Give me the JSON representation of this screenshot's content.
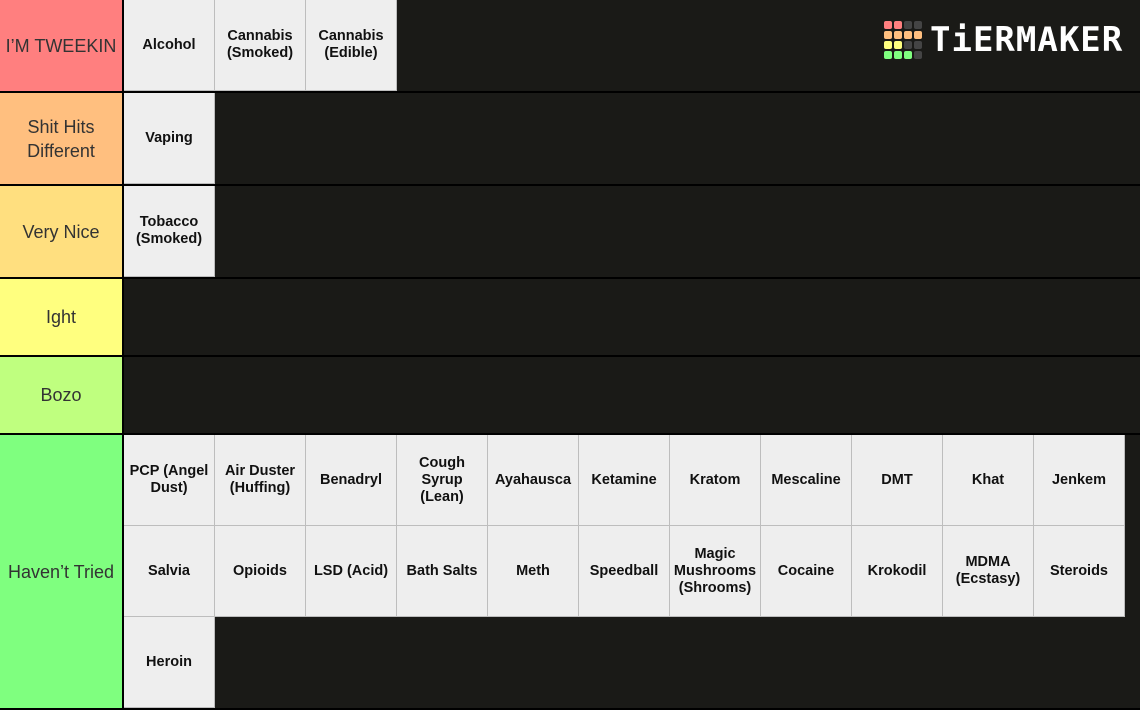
{
  "brand": {
    "name": "TiERMAKER",
    "grid_colors": [
      "#ff7f7f",
      "#ff7f7f",
      "#444444",
      "#444444",
      "#ffbf7f",
      "#ffbf7f",
      "#ffbf7f",
      "#ffbf7f",
      "#ffff7f",
      "#ffff7f",
      "#444444",
      "#444444",
      "#7fff7f",
      "#7fff7f",
      "#7fff7f",
      "#444444"
    ]
  },
  "tiers": [
    {
      "label": "I’M TWEEKIN",
      "color": "#ff7f7f",
      "items": [
        "Alcohol",
        "Cannabis (Smoked)",
        "Cannabis (Edible)"
      ]
    },
    {
      "label": "Shit Hits Different",
      "color": "#ffbf7f",
      "items": [
        "Vaping"
      ]
    },
    {
      "label": "Very Nice",
      "color": "#ffdf7f",
      "items": [
        "Tobacco (Smoked)"
      ]
    },
    {
      "label": "Ight",
      "color": "#ffff7f",
      "items": []
    },
    {
      "label": "Bozo",
      "color": "#bfff7f",
      "items": []
    },
    {
      "label": "Haven’t Tried",
      "color": "#7fff7f",
      "items": [
        "PCP (Angel Dust)",
        "Air Duster (Huffing)",
        "Benadryl",
        "Cough Syrup (Lean)",
        "Ayahausca",
        "Ketamine",
        "Kratom",
        "Mescaline",
        "DMT",
        "Khat",
        "Jenkem",
        "Salvia",
        "Opioids",
        "LSD (Acid)",
        "Bath Salts",
        "Meth",
        "Speedball",
        "Magic Mushrooms (Shrooms)",
        "Cocaine",
        "Krokodil",
        "MDMA (Ecstasy)",
        "Steroids",
        "Heroin"
      ]
    }
  ]
}
